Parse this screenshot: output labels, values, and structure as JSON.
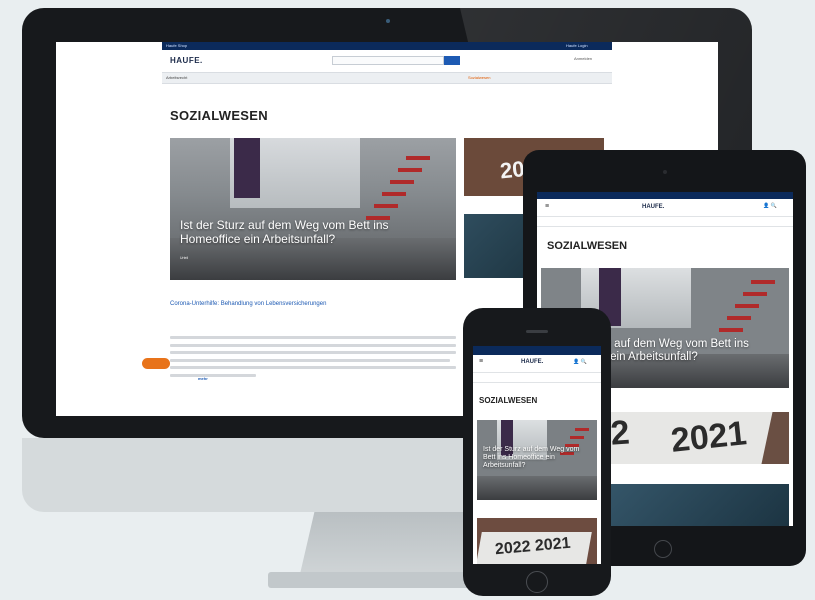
{
  "brand": {
    "logo_text": "HAUFE.",
    "accent": "#e8731a",
    "navy": "#0b2a5b",
    "link_blue": "#1d5ab3"
  },
  "desktop": {
    "topbar": {
      "left_link": "Haufe Shop",
      "right_link": "Haufe Login"
    },
    "search_placeholder": "Suchbegriff",
    "login_label": "Anmelden",
    "nav_items": [
      "Arbeitsrecht",
      "Sozialwesen"
    ],
    "nav_active": "Sozialwesen",
    "section_title": "SOZIALWESEN",
    "hero": {
      "title": "Ist der Sturz auf dem Weg vom Bett ins Homeoffice ein Arbeitsunfall?",
      "meta": "Urteil"
    },
    "hero_caption": "",
    "article2": {
      "title": "Corona-Unterhilfe: Behandlung von Lebensversicherungen",
      "meta": "",
      "more_label": "mehr"
    },
    "side1": {
      "caption": "",
      "image_text": "2022",
      "meta": ""
    },
    "side2": {
      "caption": "",
      "meta": ""
    },
    "badge": ""
  },
  "tablet": {
    "logo_text": "HAUFE.",
    "section_title": "SOZIALWESEN",
    "hero_title": "Ist der Sturz auf dem Weg vom Bett ins Homeoffice ein Arbeitsunfall?",
    "hero_meta": "",
    "card2_left": "2022",
    "card2_right": "2021",
    "card3_title": ""
  },
  "phone": {
    "logo_text": "HAUFE.",
    "section_title": "SOZIALWESEN",
    "crumb": "",
    "hero_title": "Ist der Sturz auf dem Weg vom Bett ins Homeoffice ein Arbeitsunfall?",
    "caption": "",
    "card2_caption": "",
    "card2_num": "2022 2021"
  }
}
